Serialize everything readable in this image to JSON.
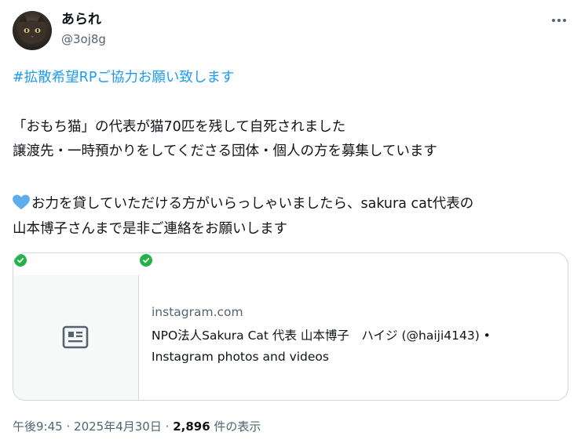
{
  "user": {
    "display_name": "あられ",
    "handle": "@3oj8g"
  },
  "tweet": {
    "hashtag_line": "#拡散希望RPご協力お願い致します",
    "line1": "「おもち猫」の代表が猫70匹を残して自死されました",
    "line2": "譲渡先・一時預かりをしてくださる団体・個人の方を募集しています",
    "line3": "お力を貸していただける方がいらっしゃいましたら、sakura cat代表の",
    "line4": "山本博子さんまで是非ご連絡をお願いします",
    "heart_icon": "blue-heart-emoji",
    "heart_color": "#5dadec"
  },
  "card": {
    "domain": "instagram.com",
    "title_line1": "NPO法人Sakura Cat 代表 山本博子　ハイジ (@haiji4143) •",
    "title_line2": "Instagram photos and videos",
    "thumbnail_icon": "document-icon",
    "verified_icon": "check-circle-icon",
    "verified_color": "#25b34a"
  },
  "meta": {
    "time": "午後9:45",
    "separator": "·",
    "date": "2025年4月30日",
    "views_count": "2,896",
    "views_label": "件の表示"
  },
  "colors": {
    "link": "#1d9bf0",
    "secondary_text": "#536471",
    "border": "#cfd9de"
  }
}
